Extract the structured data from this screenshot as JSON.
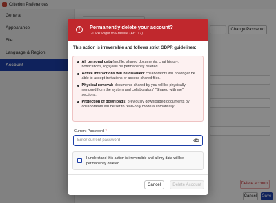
{
  "window": {
    "title": "Criterion Preferences"
  },
  "sidebar": {
    "items": [
      {
        "label": "General"
      },
      {
        "label": "Appearance"
      },
      {
        "label": "File"
      },
      {
        "label": "Language & Region"
      },
      {
        "label": "Account"
      }
    ]
  },
  "main": {
    "change_password_label": "Change Password",
    "delete_account_label": "Delete account",
    "cancel_label": "Cancel",
    "save_label": "Save"
  },
  "modal": {
    "title": "Permanently delete your account?",
    "subtitle": "GDPR Right to Erasure (Art. 17)",
    "intro": "This action is irreversible and follows strict GDPR guidelines:",
    "items": [
      {
        "title": "All personal data",
        "text": " (profile, shared documents, chat history, notifications, logs) will be permanently deleted."
      },
      {
        "title": "Active interactions will be disabled:",
        "text": " collaborators will no longer be able to accept invitations or access shared files."
      },
      {
        "title": "Physical removal:",
        "text": " documents shared by you will be physically removed from the system and collaborators' \"Shared with me\" sections."
      },
      {
        "title": "Protection of downloads:",
        "text": " previously downloaded documents by collaborators will be set to read-only mode automatically."
      }
    ],
    "password_label": "Current Password",
    "password_required": "*",
    "password_placeholder": "Enter current password",
    "confirm_text": "I understand this action is irreversible and all my data will be permanently deleted",
    "cancel_label": "Cancel",
    "delete_label": "Delete Account"
  },
  "colors": {
    "accent": "#1d3fa8",
    "danger": "#c0282d",
    "warning_bg": "#fdf1f1"
  }
}
